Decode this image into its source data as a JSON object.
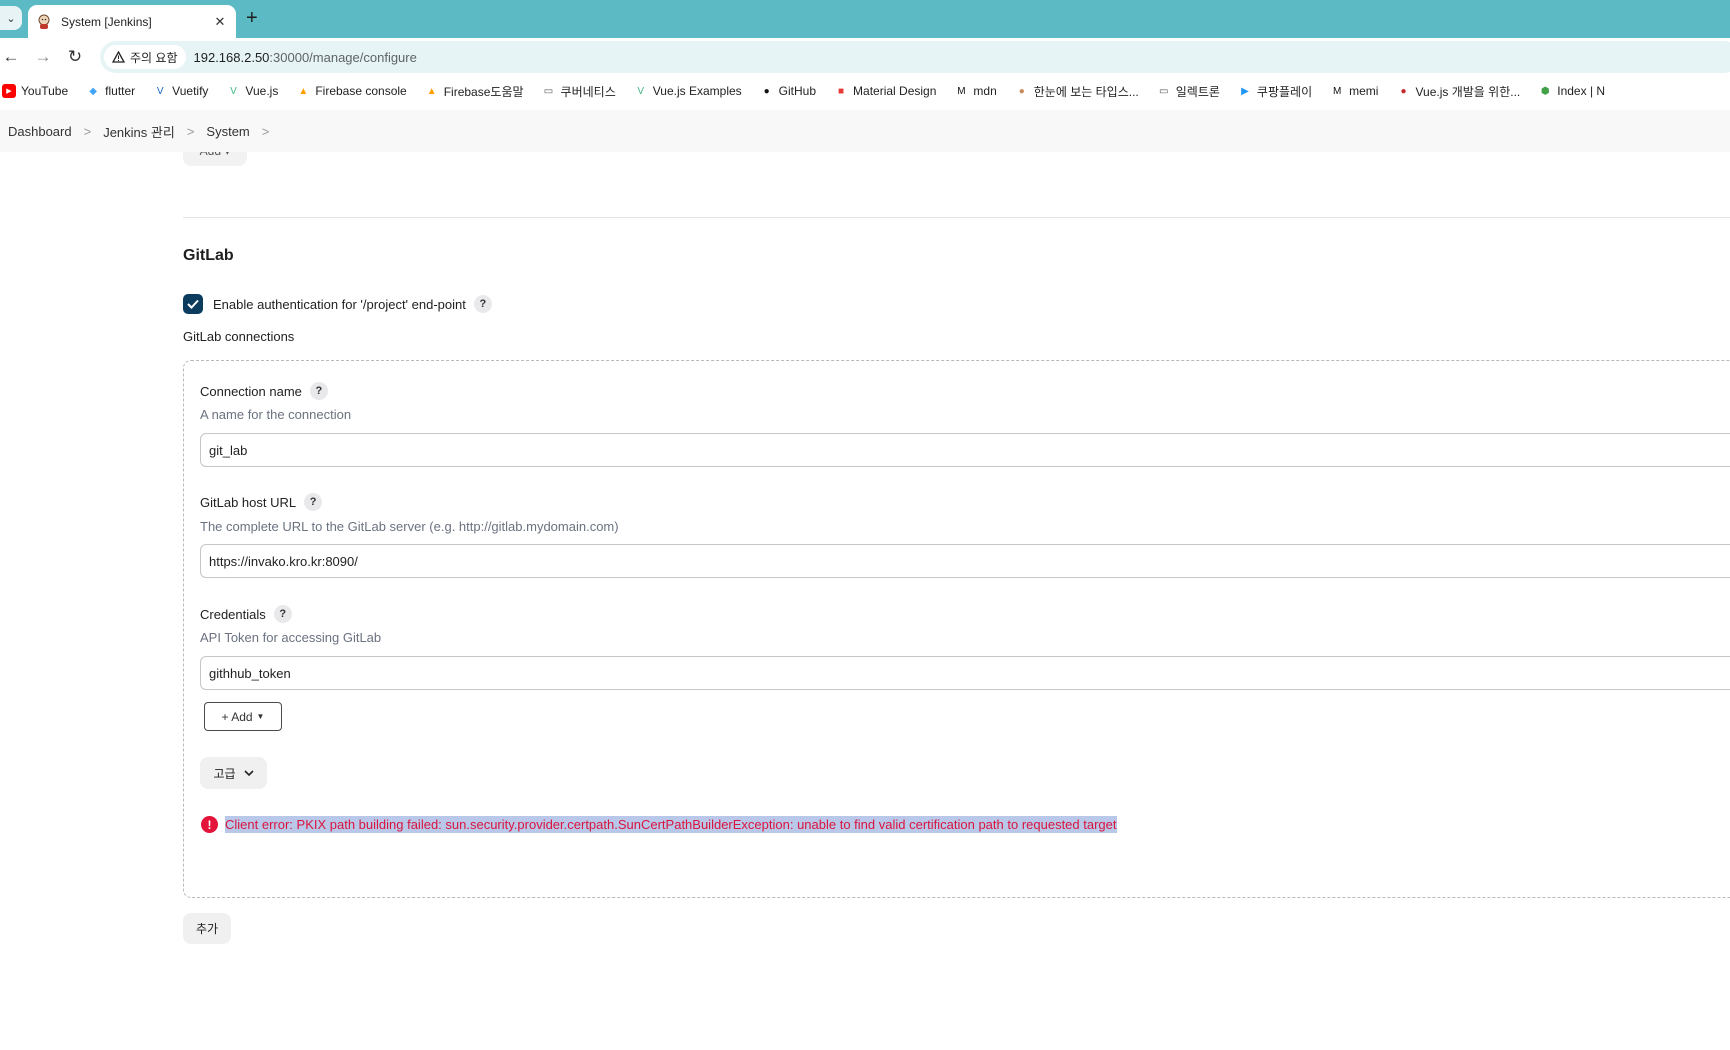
{
  "browser": {
    "tab_title": "System [Jenkins]",
    "new_tab": "+",
    "security_chip": "주의 요함",
    "url_host": "192.168.2.50",
    "url_rest": ":30000/manage/configure",
    "bookmarks": [
      {
        "label": "YouTube",
        "icon": "youtube-icon",
        "color": "#ff0000"
      },
      {
        "label": "flutter",
        "icon": "flutter-icon",
        "color": "#42a5f5"
      },
      {
        "label": "Vuetify",
        "icon": "vuetify-icon",
        "color": "#1867c0"
      },
      {
        "label": "Vue.js",
        "icon": "vue-icon",
        "color": "#41b883"
      },
      {
        "label": "Firebase console",
        "icon": "firebase-icon",
        "color": "#ffa000"
      },
      {
        "label": "Firebase도움말",
        "icon": "firebase-icon",
        "color": "#ffa000"
      },
      {
        "label": "쿠버네티스",
        "icon": "folder-icon",
        "color": "#555555"
      },
      {
        "label": "Vue.js Examples",
        "icon": "vue-icon",
        "color": "#41b883"
      },
      {
        "label": "GitHub",
        "icon": "github-icon",
        "color": "#111111"
      },
      {
        "label": "Material Design",
        "icon": "material-design-icon",
        "color": "#e53935"
      },
      {
        "label": "mdn",
        "icon": "mdn-icon",
        "color": "#111111"
      },
      {
        "label": "한눈에 보는 타입스...",
        "icon": "avatar-icon",
        "color": "#c98a5a"
      },
      {
        "label": "일렉트론",
        "icon": "folder-icon",
        "color": "#555555"
      },
      {
        "label": "쿠팡플레이",
        "icon": "coupang-play-icon",
        "color": "#2196f3"
      },
      {
        "label": "memi",
        "icon": "memi-icon",
        "color": "#111111"
      },
      {
        "label": "Vue.js 개발을 위한...",
        "icon": "vue-dev-icon",
        "color": "#c62828"
      },
      {
        "label": "Index | N",
        "icon": "node-icon",
        "color": "#43a047"
      }
    ]
  },
  "breadcrumb": {
    "items": [
      "Dashboard",
      "Jenkins 관리",
      "System"
    ],
    "separator": ">"
  },
  "page": {
    "top_add_label": "Add ▾",
    "section_title": "GitLab",
    "enable_auth_label": "Enable authentication for '/project' end-point",
    "connections_label": "GitLab connections",
    "help_glyph": "?",
    "connection_name": {
      "label": "Connection name",
      "description": "A name for the connection",
      "value": "git_lab"
    },
    "host_url": {
      "label": "GitLab host URL",
      "description": "The complete URL to the GitLab server (e.g. http://gitlab.mydomain.com)",
      "value": "https://invako.kro.kr:8090/"
    },
    "credentials": {
      "label": "Credentials",
      "description": "API Token for accessing GitLab",
      "value": "githhub_token",
      "add_label": "+ Add"
    },
    "advanced_label": "고급",
    "error_text": "Client error: PKIX path building failed: sun.security.provider.certpath.SunCertPathBuilderException: unable to find valid certification path to requested target",
    "bottom_add_label": "추가"
  },
  "colors": {
    "tabstrip": "#5bbac3",
    "checkbox": "#0b3c5d",
    "error": "#d9143f",
    "error_highlight": "#b9c8e8"
  }
}
